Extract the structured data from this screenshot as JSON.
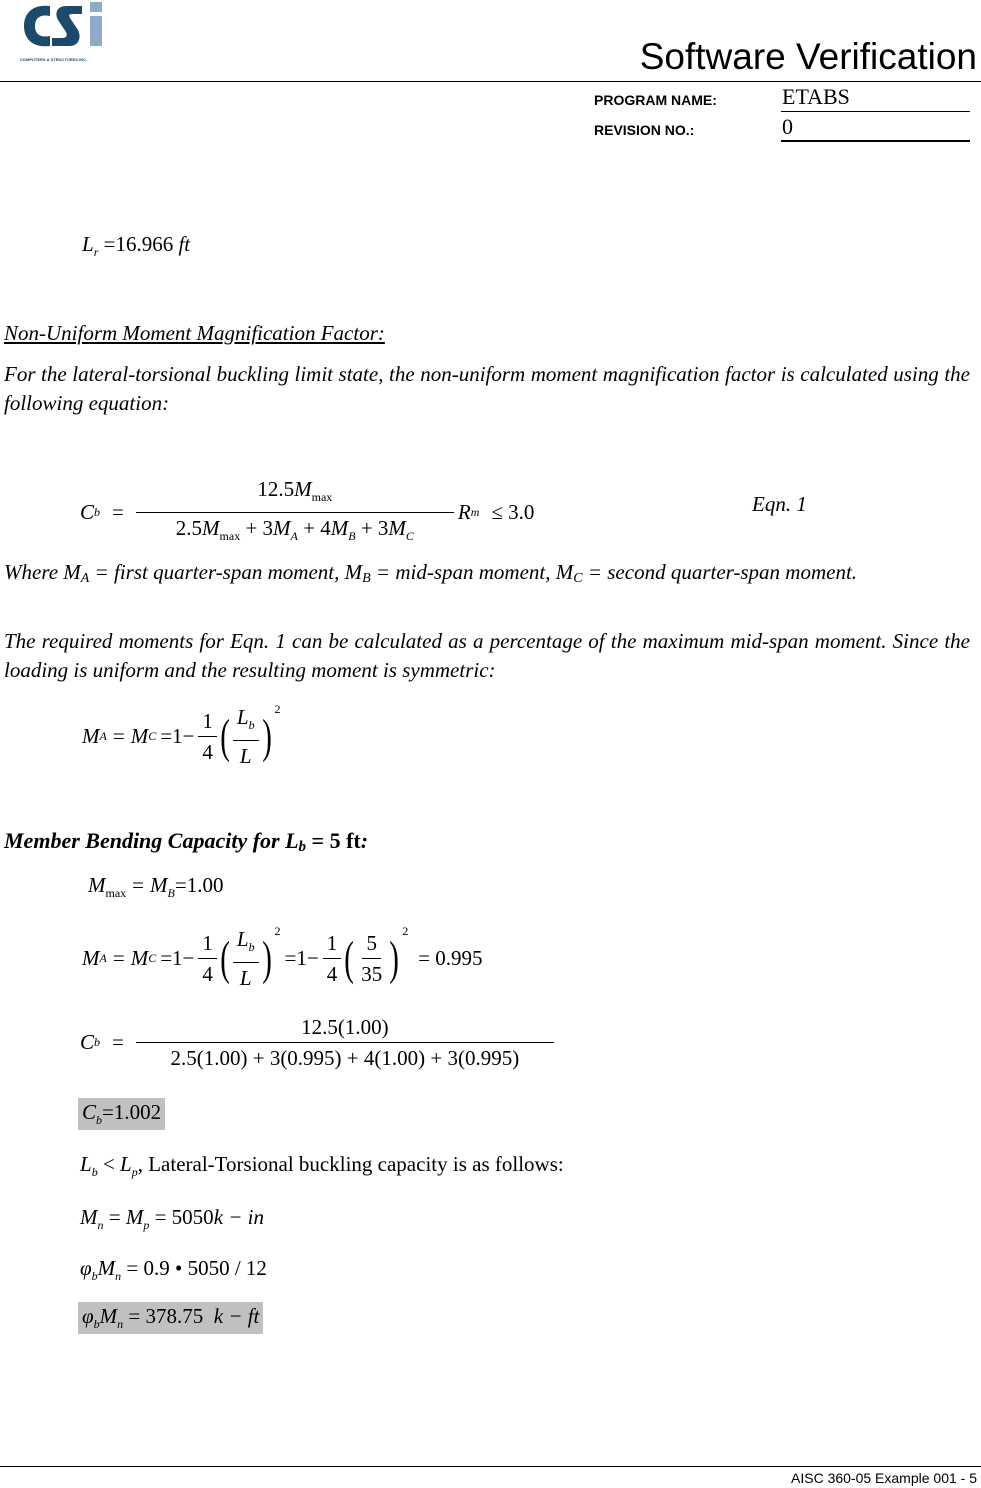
{
  "header": {
    "logo_text": "CSi",
    "logo_tagline": "COMPUTERS & STRUCTURES INC.",
    "title": "Software Verification",
    "program_name_label": "PROGRAM NAME:",
    "program_name_value": "ETABS",
    "revision_label": "REVISION NO.:",
    "revision_value": "0"
  },
  "lr_eq": {
    "var": "L",
    "sub": "r",
    "value": "=16.966",
    "unit": "ft"
  },
  "section1": {
    "heading": "Non-Uniform Moment Magnification Factor:",
    "intro": "For the lateral-torsional buckling limit state, the non-uniform moment magnification factor is calculated using the following equation:",
    "eqn_label": "Eqn. 1",
    "where_text": "Where M_A = first quarter-span moment, M_B = mid-span moment, M_C = second quarter-span moment.",
    "where_parts": [
      "Where M",
      "A",
      " = first quarter-span moment, M",
      "B",
      " = mid-span moment, M",
      "C",
      " = second quarter-span moment."
    ],
    "required_text": "The required moments for Eqn. 1 can be calculated as a percentage of the maximum mid-span moment. Since the loading is uniform and the resulting moment is symmetric:"
  },
  "cb_formula": {
    "numerator": "12.5M max",
    "denominator": "2.5M max + 3M A + 4M B + 3M C",
    "rm": "R m",
    "limit": "≤ 3.0"
  },
  "section2": {
    "heading_prefix": "Member Bending Capacity for L",
    "heading_sub": "b",
    "heading_suffix": " = 5 ft",
    "heading_colon": ":",
    "mmax_value": "=1.00",
    "ma_result": "= 0.995",
    "lb": "5",
    "l": "35",
    "cb_num": "12.5(1.00)",
    "cb_den": "2.5(1.00) + 3(0.995) + 4(1.00) + 3(0.995)",
    "cb_result": "=1.002",
    "lb_lp_text": ", Lateral-Torsional buckling capacity is as follows:",
    "mn_value": "= 5050",
    "mn_unit": "k − in",
    "phimn_calc": "= 0.9 • 5050 / 12",
    "phimn_result": "= 378.75",
    "phimn_unit": "k − ft"
  },
  "footer": {
    "text": "AISC 360-05 Example 001 - 5"
  },
  "colors": {
    "logo_dark": "#1d4a6b",
    "logo_light": "#8fa9c8",
    "highlight": "#c0c0c0"
  }
}
